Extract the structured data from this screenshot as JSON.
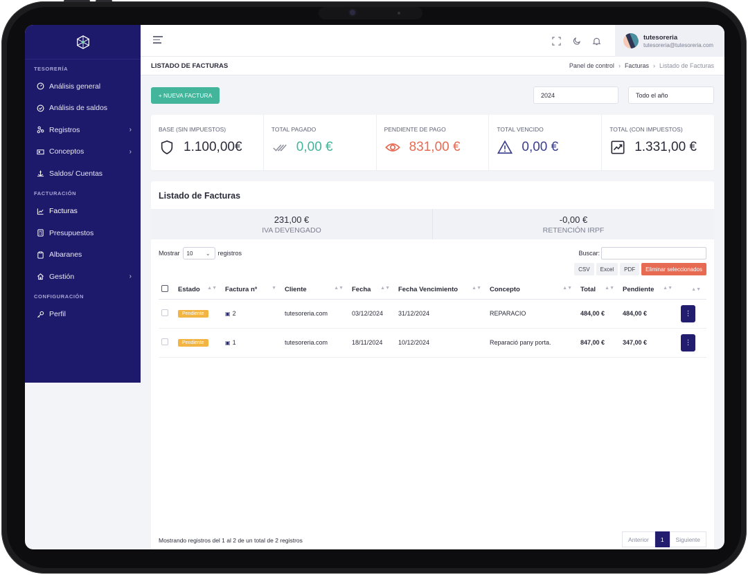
{
  "sidebar": {
    "sections": [
      {
        "title": "TESORERÍA",
        "items": [
          {
            "label": "Análisis general",
            "icon": "gauge-icon",
            "chevron": false
          },
          {
            "label": "Análisis de saldos",
            "icon": "check-circle-icon",
            "chevron": false
          },
          {
            "label": "Registros",
            "icon": "nodes-icon",
            "chevron": true
          },
          {
            "label": "Conceptos",
            "icon": "card-icon",
            "chevron": true
          },
          {
            "label": "Saldos/ Cuentas",
            "icon": "anchor-icon",
            "chevron": false
          }
        ]
      },
      {
        "title": "FACTURACIÓN",
        "items": [
          {
            "label": "Facturas",
            "icon": "chart-line-icon",
            "chevron": false,
            "active": true
          },
          {
            "label": "Presupuestos",
            "icon": "calculator-icon",
            "chevron": false
          },
          {
            "label": "Albaranes",
            "icon": "clipboard-icon",
            "chevron": false
          },
          {
            "label": "Gestión",
            "icon": "home-icon",
            "chevron": true
          }
        ]
      },
      {
        "title": "CONFIGURACIÓN",
        "items": [
          {
            "label": "Perfil",
            "icon": "key-icon",
            "chevron": false
          }
        ]
      }
    ]
  },
  "topbar": {
    "user_name": "tutesoreria",
    "user_email": "tutesoreria@tutesoreria.com"
  },
  "page": {
    "title": "LISTADO DE FACTURAS",
    "breadcrumb": [
      "Panel de control",
      "Facturas",
      "Listado de Facturas"
    ]
  },
  "controls": {
    "new_invoice": "+ NUEVA FACTURA",
    "year": "2024",
    "period": "Todo el año"
  },
  "stats": [
    {
      "label": "BASE (SIN IMPUESTOS)",
      "value": "1.100,00€",
      "color": "#2b2b3a",
      "icon": "shield-icon"
    },
    {
      "label": "TOTAL PAGADO",
      "value": "0,00 €",
      "color": "#43b59a",
      "icon": "double-check-icon"
    },
    {
      "label": "PENDIENTE DE PAGO",
      "value": "831,00 €",
      "color": "#e76a52",
      "icon": "eye-icon"
    },
    {
      "label": "TOTAL VENCIDO",
      "value": "0,00 €",
      "color": "#3b3f8c",
      "icon": "warning-icon"
    },
    {
      "label": "TOTAL (CON IMPUESTOS)",
      "value": "1.331,00 €",
      "color": "#2b2b3a",
      "icon": "trend-up-icon"
    }
  ],
  "listing": {
    "title": "Listado de Facturas",
    "summary": [
      {
        "value": "231,00 €",
        "label": "IVA DEVENGADO"
      },
      {
        "value": "-0,00 €",
        "label": "RETENCIÓN IRPF"
      }
    ],
    "show_prefix": "Mostrar",
    "page_length": "10",
    "show_suffix": "registros",
    "search_label": "Buscar:",
    "exports": [
      "CSV",
      "Excel",
      "PDF"
    ],
    "delete_selected": "Eliminar seleccionados",
    "columns": [
      "Estado",
      "Factura nº",
      "Cliente",
      "Fecha",
      "Fecha Vencimiento",
      "Concepto",
      "Total",
      "Pendiente"
    ],
    "rows": [
      {
        "estado": "Pendiente",
        "factura": "2",
        "cliente": "tutesoreria.com",
        "fecha": "03/12/2024",
        "vencimiento": "31/12/2024",
        "concepto": "REPARACIO",
        "total": "484,00 €",
        "pendiente": "484,00 €"
      },
      {
        "estado": "Pendiente",
        "factura": "1",
        "cliente": "tutesoreria.com",
        "fecha": "18/11/2024",
        "vencimiento": "10/12/2024",
        "concepto": "Reparació pany porta.",
        "total": "847,00 €",
        "pendiente": "347,00 €"
      }
    ],
    "footer_info": "Mostrando registros del 1 al 2 de un total de 2 registros",
    "pagination": {
      "prev": "Anterior",
      "current": "1",
      "next": "Siguiente"
    }
  }
}
